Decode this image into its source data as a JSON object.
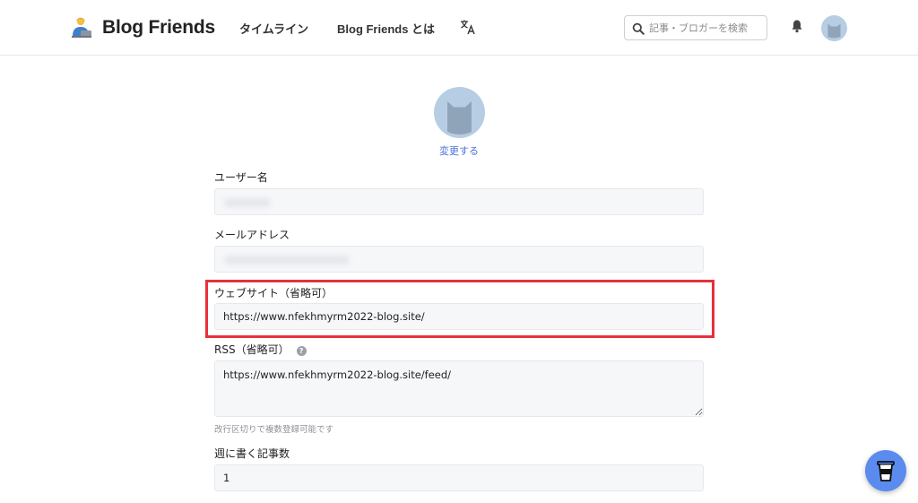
{
  "header": {
    "brand": "Blog Friends",
    "nav": {
      "timeline": "タイムライン",
      "about": "Blog Friends とは"
    },
    "search": {
      "placeholder": "記事・ブロガーを検索",
      "value": ""
    },
    "icons": {
      "logo": "person-at-laptop-icon",
      "translate": "translate-icon",
      "search": "search-icon",
      "bell": "bell-icon",
      "avatar": "cat-avatar-icon"
    }
  },
  "profile": {
    "change_avatar_label": "変更する"
  },
  "form": {
    "username": {
      "label": "ユーザー名",
      "value": ""
    },
    "email": {
      "label": "メールアドレス",
      "value": ""
    },
    "website": {
      "label": "ウェブサイト（省略可）",
      "value": "https://www.nfekhmyrm2022-blog.site/"
    },
    "rss": {
      "label": "RSS（省略可）",
      "value": "https://www.nfekhmyrm2022-blog.site/feed/",
      "hint": "改行区切りで複数登録可能です",
      "help_icon": "question-circle-icon"
    },
    "posts_per_week": {
      "label": "週に書く記事数",
      "value": "1"
    }
  },
  "colors": {
    "accent": "#4a72d9",
    "highlight": "#e8303a",
    "avatar_bg": "#b6cde4",
    "fab": "#5b8bef"
  },
  "fab_icon": "coffee-cup-icon"
}
